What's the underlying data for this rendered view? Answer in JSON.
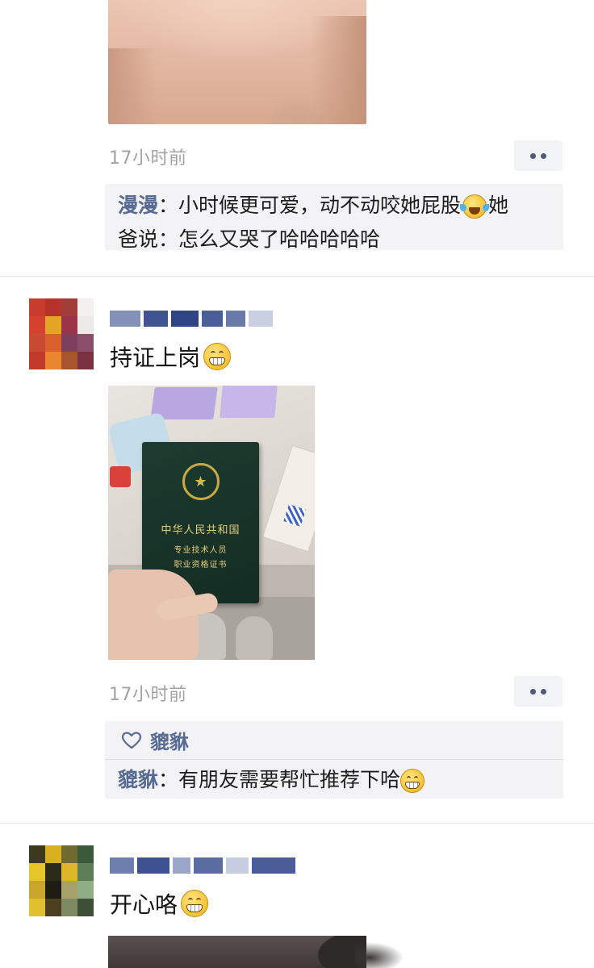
{
  "post1": {
    "time": "17小时前",
    "comment": {
      "nick": "漫漫",
      "line1": "：小时候更可爱，动不动咬她屁股",
      "line1_tail": "她",
      "line2": "爸说：怎么又哭了哈哈哈哈哈",
      "emoji": "face-with-tears-of-joy-icon"
    }
  },
  "post2": {
    "text": "持证上岗",
    "emoji": "grinning-face-icon",
    "photo": {
      "cert_line1": "中华人民共和国",
      "cert_line2": "专业技术人员",
      "cert_line3": "职业资格证书"
    },
    "time": "17小时前",
    "likes": {
      "names": "貔貅"
    },
    "comment": {
      "nick": "貔貅",
      "text": "：有朋友需要帮忙推荐下哈",
      "emoji": "grinning-face-icon"
    }
  },
  "post3": {
    "text": "开心咯",
    "emoji": "grinning-face-icon"
  },
  "colors": {
    "nickname": "#576b95",
    "timestamp": "#a3a3a3",
    "comment_bg": "#f3f3f5"
  }
}
